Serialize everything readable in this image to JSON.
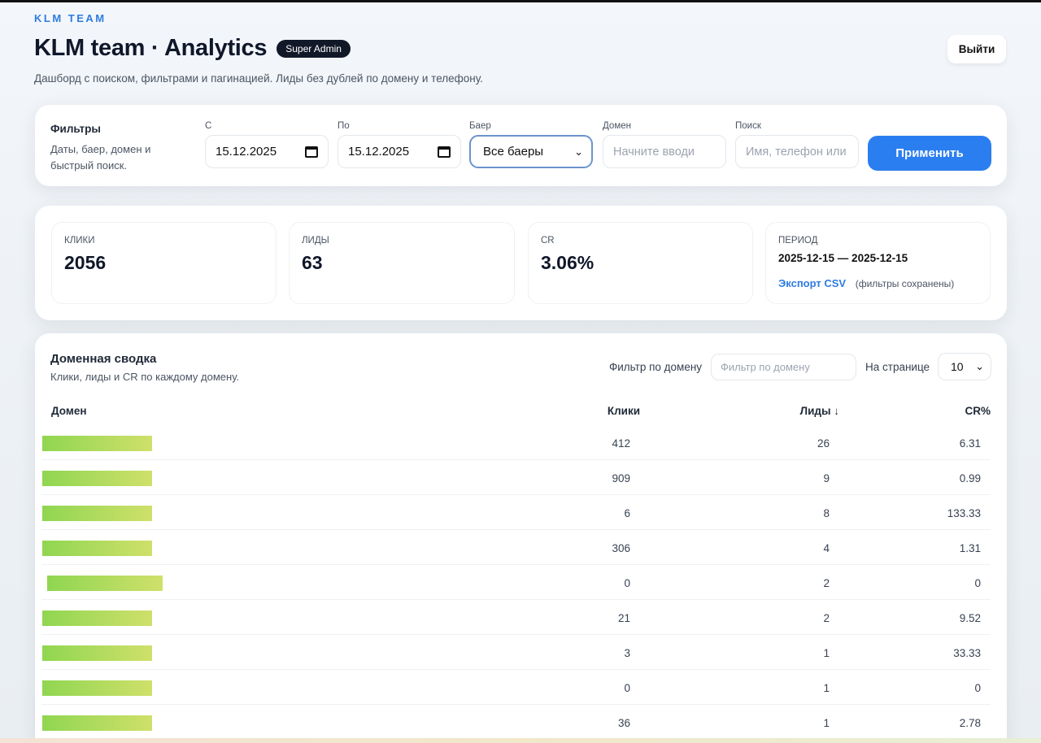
{
  "brand": "KLM TEAM",
  "header": {
    "title": "KLM team · Analytics",
    "badge": "Super Admin",
    "subtitle": "Дашборд с поиском, фильтрами и пагинацией. Лиды без дублей по домену и телефону.",
    "logout_label": "Выйти"
  },
  "filters": {
    "title": "Фильтры",
    "description": "Даты, баер, домен и быстрый поиск.",
    "from_label": "С",
    "from_value": "15.12.2025",
    "to_label": "По",
    "to_value": "15.12.2025",
    "buyer_label": "Баер",
    "buyer_value": "Все баеры",
    "domain_label": "Домен",
    "domain_placeholder": "Начните вводи",
    "search_label": "Поиск",
    "search_placeholder": "Имя, телефон или",
    "apply_label": "Применить"
  },
  "stats": {
    "clicks_label": "КЛИКИ",
    "clicks_value": "2056",
    "leads_label": "ЛИДЫ",
    "leads_value": "63",
    "cr_label": "CR",
    "cr_value": "3.06%",
    "period_label": "ПЕРИОД",
    "period_value": "2025-12-15 — 2025-12-15",
    "export_label": "Экспорт CSV",
    "export_note": "(фильтры сохранены)"
  },
  "domain_table": {
    "title": "Доменная сводка",
    "subtitle": "Клики, лиды и CR по каждому домену.",
    "filter_label": "Фильтр по домену",
    "filter_placeholder": "Фильтр по домену",
    "per_page_label": "На странице",
    "per_page_value": "10",
    "columns": [
      "Домен",
      "Клики",
      "Лиды ↓",
      "CR%"
    ],
    "rows": [
      {
        "clicks": "412",
        "leads": "26",
        "cr": "6.31"
      },
      {
        "clicks": "909",
        "leads": "9",
        "cr": "0.99"
      },
      {
        "clicks": "6",
        "leads": "8",
        "cr": "133.33"
      },
      {
        "clicks": "306",
        "leads": "4",
        "cr": "1.31"
      },
      {
        "clicks": "0",
        "leads": "2",
        "cr": "0"
      },
      {
        "clicks": "21",
        "leads": "2",
        "cr": "9.52"
      },
      {
        "clicks": "3",
        "leads": "1",
        "cr": "33.33"
      },
      {
        "clicks": "0",
        "leads": "1",
        "cr": "0"
      },
      {
        "clicks": "36",
        "leads": "1",
        "cr": "2.78"
      }
    ]
  },
  "colors": {
    "accent": "#2a7ef0",
    "brand": "#2d7be0",
    "bar_start": "#8fd651",
    "bar_end": "#cfe06a"
  }
}
